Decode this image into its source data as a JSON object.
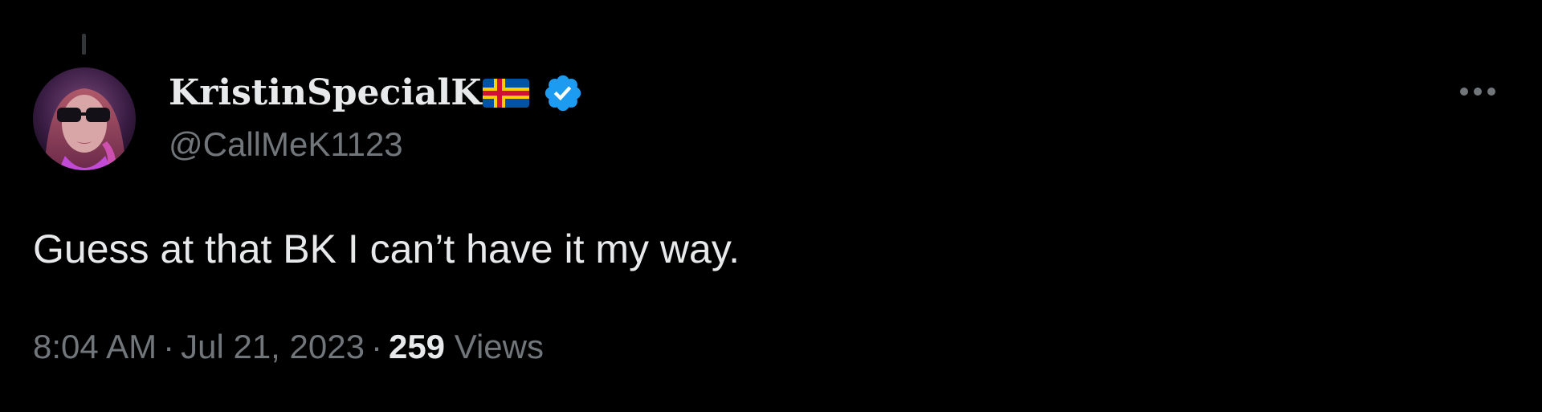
{
  "tweet": {
    "author": {
      "display_name": "KristinSpecialK",
      "flag_icon": "aland-flag-icon",
      "verified_icon": "verified-badge-icon",
      "handle": "@CallMeK1123",
      "avatar": "avatar"
    },
    "text": "Guess at that BK I can’t have it my way.",
    "time": "8:04 AM",
    "separator": "·",
    "date": "Jul 21, 2023",
    "views_count": "259",
    "views_label": "Views",
    "more_icon": "more-options-icon"
  },
  "colors": {
    "background": "#000000",
    "primary_text": "#e7e9ea",
    "secondary_text": "#71767b",
    "verified_blue": "#1d9bf0"
  }
}
